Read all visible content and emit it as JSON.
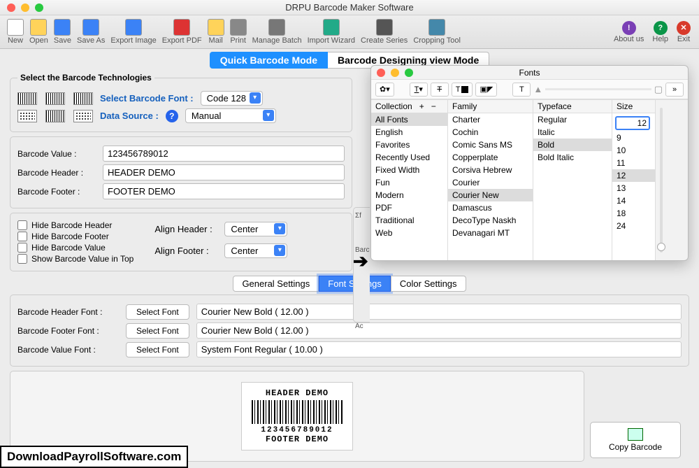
{
  "window": {
    "title": "DRPU Barcode Maker Software"
  },
  "toolbar": [
    {
      "label": "New",
      "icon": "file-icon",
      "color": "#fff",
      "border": "#8bb"
    },
    {
      "label": "Open",
      "icon": "folder-open-icon",
      "color": "#ffd35a"
    },
    {
      "label": "Save",
      "icon": "save-icon",
      "color": "#3b82f6"
    },
    {
      "label": "Save As",
      "icon": "save-as-icon",
      "color": "#3b82f6"
    },
    {
      "label": "Export Image",
      "icon": "export-image-icon",
      "color": "#3b82f6"
    },
    {
      "label": "Export PDF",
      "icon": "export-pdf-icon",
      "color": "#d33"
    },
    {
      "label": "Mail",
      "icon": "mail-icon",
      "color": "#ffd35a"
    },
    {
      "label": "Print",
      "icon": "print-icon",
      "color": "#888"
    },
    {
      "label": "Manage Batch",
      "icon": "batch-icon",
      "color": "#777"
    },
    {
      "label": "Import Wizard",
      "icon": "import-icon",
      "color": "#2a8"
    },
    {
      "label": "Create Series",
      "icon": "series-icon",
      "color": "#555"
    },
    {
      "label": "Cropping Tool",
      "icon": "crop-icon",
      "color": "#48a"
    }
  ],
  "toolbar_right": [
    {
      "label": "About us",
      "bg": "#7a3fb5",
      "ch": "!"
    },
    {
      "label": "Help",
      "bg": "#0a9548",
      "ch": "?"
    },
    {
      "label": "Exit",
      "bg": "#d83a2b",
      "ch": "✕"
    }
  ],
  "modes": {
    "quick": "Quick Barcode Mode",
    "design": "Barcode Designing view Mode"
  },
  "tech": {
    "legend": "Select the Barcode Technologies",
    "font_label": "Select Barcode Font :",
    "font_value": "Code 128",
    "ds_label": "Data Source :",
    "ds_value": "Manual"
  },
  "fields": {
    "value_label": "Barcode Value :",
    "value": "123456789012",
    "header_label": "Barcode Header :",
    "header": "HEADER DEMO",
    "footer_label": "Barcode Footer :",
    "footer": "FOOTER DEMO"
  },
  "opts": {
    "hide_header": "Hide Barcode Header",
    "hide_footer": "Hide Barcode Footer",
    "hide_value": "Hide Barcode Value",
    "show_top": "Show Barcode Value in Top",
    "align_header_label": "Align Header :",
    "align_header": "Center",
    "align_footer_label": "Align Footer :",
    "align_footer": "Center"
  },
  "settings_tabs": {
    "general": "General Settings",
    "font": "Font Settings",
    "color": "Color Settings"
  },
  "fonts": {
    "header_label": "Barcode Header Font :",
    "header_val": "Courier New Bold ( 12.00 )",
    "footer_label": "Barcode Footer Font :",
    "footer_val": "Courier New Bold ( 12.00 )",
    "value_label": "Barcode Value Font :",
    "value_val": "System Font Regular ( 10.00 )",
    "select_btn": "Select Font"
  },
  "preview": {
    "header": "HEADER DEMO",
    "value": "123456789012",
    "footer": "FOOTER DEMO"
  },
  "copy_btn": "Copy Barcode",
  "watermark": "DownloadPayrollSoftware.com",
  "fp": {
    "title": "Fonts",
    "headers": {
      "collection": "Collection",
      "family": "Family",
      "typeface": "Typeface",
      "size": "Size"
    },
    "collections": [
      "All Fonts",
      "English",
      "Favorites",
      "Recently Used",
      "Fixed Width",
      "Fun",
      "Modern",
      "PDF",
      "Traditional",
      "Web"
    ],
    "families": [
      "Charter",
      "Cochin",
      "Comic Sans MS",
      "Copperplate",
      "Corsiva Hebrew",
      "Courier",
      "Courier New",
      "Damascus",
      "DecoType Naskh",
      "Devanagari MT"
    ],
    "typefaces": [
      "Regular",
      "Italic",
      "Bold",
      "Bold Italic"
    ],
    "sizes": [
      "9",
      "10",
      "11",
      "12",
      "13",
      "14",
      "18",
      "24"
    ],
    "collection_sel": "All Fonts",
    "family_sel": "Courier New",
    "typeface_sel": "Bold",
    "size_sel": "12",
    "size_input": "12"
  },
  "half": {
    "a": "Σf",
    "b": "Barc",
    "c": "Ac"
  }
}
